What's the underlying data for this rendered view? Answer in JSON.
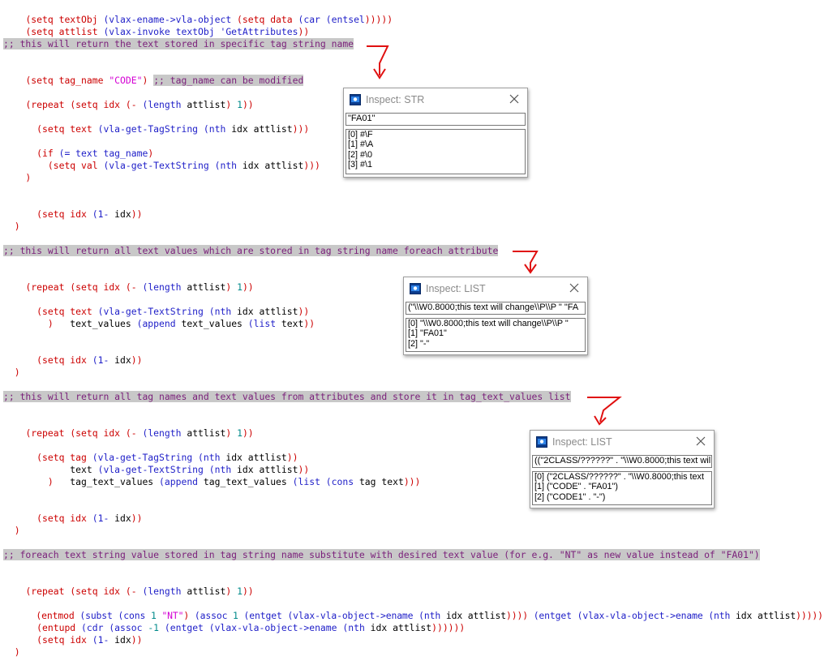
{
  "code": {
    "l1": [
      "(setq textObj ",
      "(vlax-ename->vla-object ",
      "(setq data ",
      "(car ",
      "(entsel",
      ")))))"
    ],
    "l2": [
      "(setq attlist ",
      "(vlax-invoke textObj 'GetAttributes",
      "))"
    ],
    "c1": ";; this will return the text stored in specific tag string name",
    "l3": [
      "(setq tag_name ",
      "\"CODE\"",
      ") ",
      ";; tag_name can be modified"
    ],
    "l4": [
      "(repeat ",
      "(setq idx ",
      "(- ",
      "(length ",
      "attlist",
      ") ",
      "1",
      "))"
    ],
    "l5": [
      "  (setq text ",
      "(vla-get-TagString ",
      "(nth ",
      "idx attlist",
      ")))"
    ],
    "l6": [
      "  (if ",
      "(= text tag_name",
      ")"
    ],
    "l7": [
      "    (setq val ",
      "(vla-get-TextString ",
      "(nth ",
      "idx attlist",
      ")))"
    ],
    "l8": "    )",
    "l9": [
      "  (setq idx ",
      "(1- ",
      "idx",
      "))"
    ],
    "l10": "  )",
    "c2": ";; this will return all text values which are stored in tag string name foreach attribute",
    "l11": [
      "(repeat ",
      "(setq idx ",
      "(- ",
      "(length ",
      "attlist",
      ") ",
      "1",
      "))"
    ],
    "l12": [
      "  (setq text ",
      "(vla-get-TextString ",
      "(nth ",
      "idx attlist",
      "))"
    ],
    "l13": [
      "        text_values ",
      "(append ",
      "text_values ",
      "(list ",
      "text",
      "))"
    ],
    "l14": "        )",
    "l15": [
      "  (setq idx ",
      "(1- ",
      "idx",
      "))"
    ],
    "l16": "  )",
    "c3": ";; this will return all tag names and text values from attributes and store it in tag_text_values list",
    "l17": [
      "(repeat ",
      "(setq idx ",
      "(- ",
      "(length ",
      "attlist",
      ") ",
      "1",
      "))"
    ],
    "l18": [
      "  (setq tag ",
      "(vla-get-TagString ",
      "(nth ",
      "idx attlist",
      "))"
    ],
    "l19": [
      "        text ",
      "(vla-get-TextString ",
      "(nth ",
      "idx attlist",
      "))"
    ],
    "l20": [
      "        tag_text_values ",
      "(append ",
      "tag_text_values ",
      "(list ",
      "(cons ",
      "tag text",
      ")))"
    ],
    "l21": "        )",
    "l22": [
      "  (setq idx ",
      "(1- ",
      "idx",
      "))"
    ],
    "l23": "  )",
    "c4": ";; foreach text string value stored in tag string name substitute with desired text value (for e.g. \"NT\" as new value instead of \"FA01\")",
    "l24": [
      "(repeat ",
      "(setq idx ",
      "(- ",
      "(length ",
      "attlist",
      ") ",
      "1",
      "))"
    ],
    "l25": [
      "  (entmod ",
      "(subst ",
      "(cons ",
      "1 ",
      "\"NT\"",
      ") ",
      "(assoc ",
      "1 ",
      "(entget ",
      "(vlax-vla-object->ename ",
      "(nth ",
      "idx attlist",
      ")))) ",
      "(entget ",
      "(vlax-vla-object->ename ",
      "(nth ",
      "idx attlist",
      ")))))"
    ],
    "l26": [
      "  (entupd ",
      "(cdr ",
      "(assoc ",
      "-1 ",
      "(entget ",
      "(vlax-vla-object->ename ",
      "(nth ",
      "idx attlist",
      "))))))"
    ],
    "l27": [
      "  (setq idx ",
      "(1- ",
      "idx",
      "))"
    ],
    "l28": "  )"
  },
  "inspect_str": {
    "title": "Inspect: STR",
    "value": "\"FA01\"",
    "items": [
      "[0] #\\F",
      "[1] #\\A",
      "[2] #\\0",
      "[3] #\\1"
    ]
  },
  "inspect_list1": {
    "title": "Inspect: LIST",
    "value": "(\"\\\\W0.8000;this text will change\\\\P\\\\P \" \"FA",
    "items": [
      "[0] \"\\\\W0.8000;this text will change\\\\P\\\\P \"",
      "[1] \"FA01\"",
      "[2] \"-\""
    ]
  },
  "inspect_list2": {
    "title": "Inspect: LIST",
    "value": "((\"2CLASS/??????\" . \"\\\\W0.8000;this text wil",
    "items": [
      "[0] (\"2CLASS/??????\" . \"\\\\W0.8000;this text",
      "[1] (\"CODE\" . \"FA01\")",
      "[2] (\"CODE1\" . \"-\")"
    ]
  },
  "colors": {
    "paren": "#cc0000",
    "keyword": "#1e1ec8",
    "string": "#d400d4",
    "number": "#008a8a",
    "comment": "#7a1f7a",
    "comment_bg": "#c8c8c8",
    "arrow": "#e01010"
  },
  "icons": [
    "inspect-window-icon",
    "close-icon",
    "arrow-annotation"
  ]
}
